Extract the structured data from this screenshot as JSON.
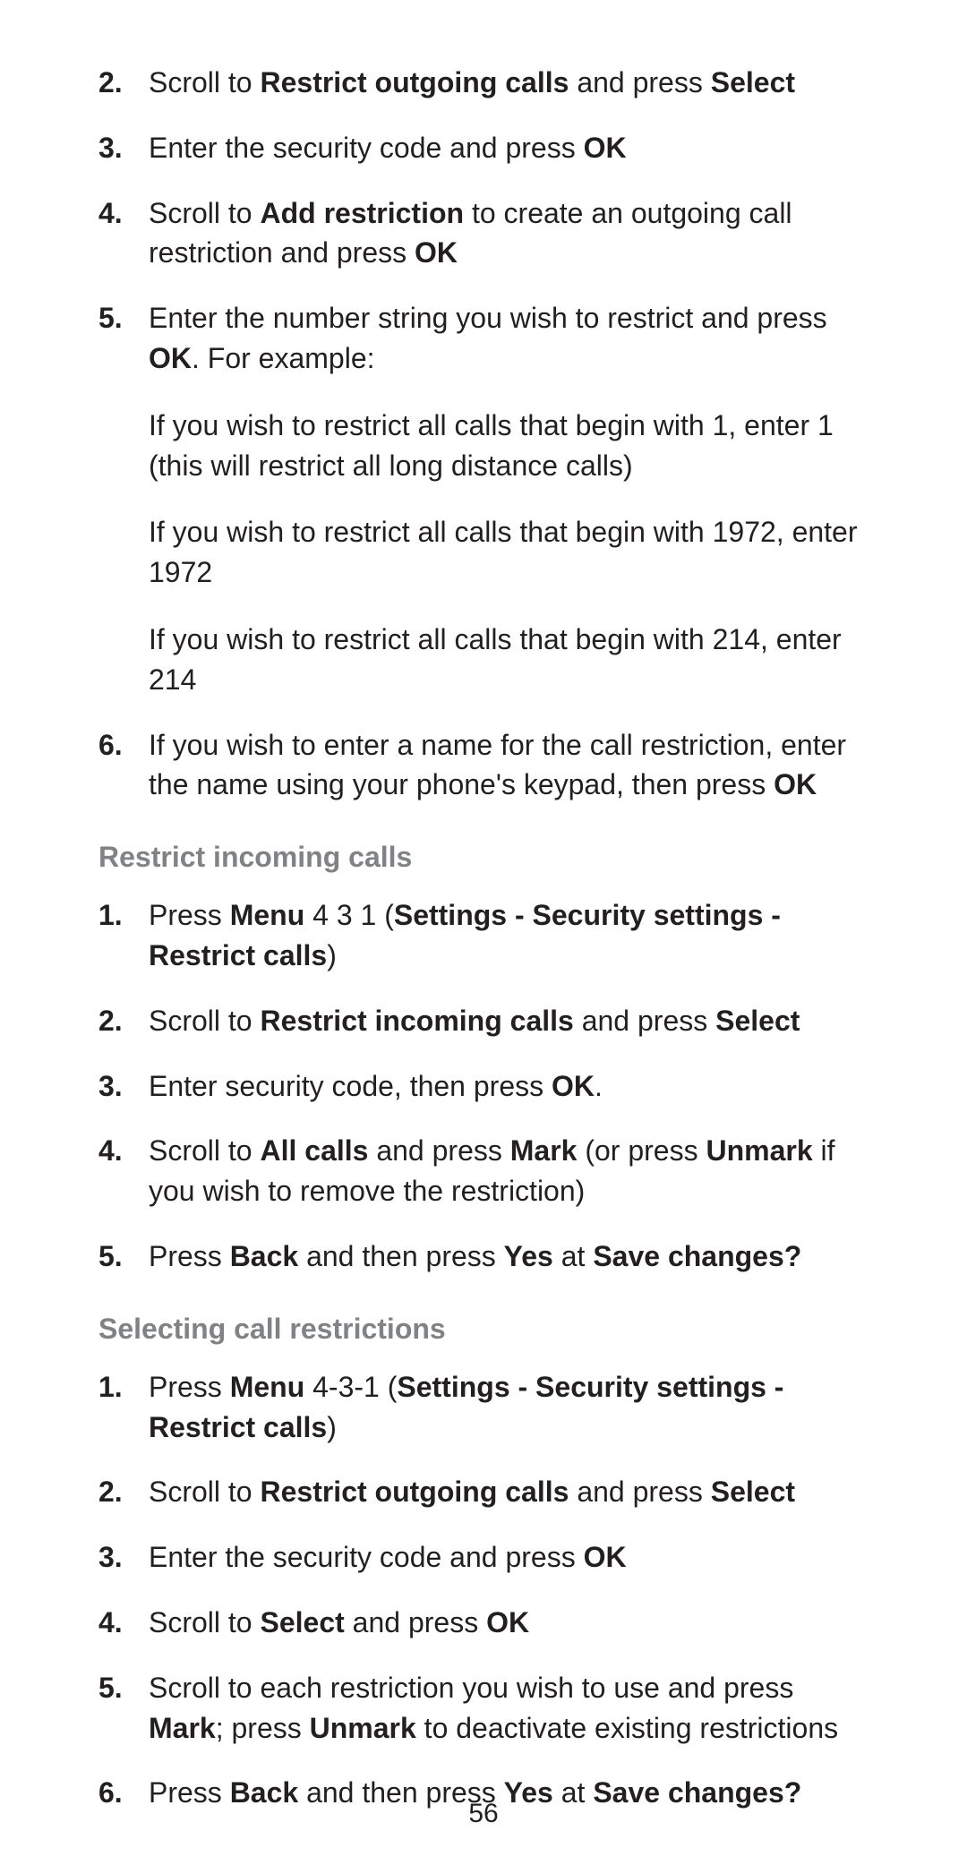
{
  "page_number": "56",
  "sections": [
    {
      "type": "continued_list",
      "items": [
        {
          "n": "2.",
          "spans": [
            {
              "t": "Scroll to ",
              "b": false
            },
            {
              "t": "Restrict outgoing calls",
              "b": true
            },
            {
              "t": " and press ",
              "b": false
            },
            {
              "t": "Select",
              "b": true
            }
          ]
        },
        {
          "n": "3.",
          "spans": [
            {
              "t": "Enter the security code and press ",
              "b": false
            },
            {
              "t": "OK",
              "b": true
            }
          ]
        },
        {
          "n": "4.",
          "spans": [
            {
              "t": "Scroll to ",
              "b": false
            },
            {
              "t": "Add restriction",
              "b": true
            },
            {
              "t": " to create an outgoing call restriction and press ",
              "b": false
            },
            {
              "t": "OK",
              "b": true
            }
          ]
        },
        {
          "n": "5.",
          "spans": [
            {
              "t": "Enter the number string you wish to restrict and press ",
              "b": false
            },
            {
              "t": "OK",
              "b": true
            },
            {
              "t": ". For example:",
              "b": false
            }
          ],
          "sub": [
            "If you wish to restrict all calls that begin with 1, enter 1 (this will restrict all long distance calls)",
            "If you wish to restrict all calls that begin with 1972, enter 1972",
            "If you wish to restrict all calls that begin with 214, enter 214"
          ]
        },
        {
          "n": "6.",
          "spans": [
            {
              "t": "If you wish to enter a name for the call restriction, enter the name using your phone's keypad, then press ",
              "b": false
            },
            {
              "t": "OK",
              "b": true
            }
          ]
        }
      ]
    },
    {
      "type": "heading",
      "title": "Restrict incoming calls"
    },
    {
      "type": "list",
      "items": [
        {
          "n": "1.",
          "spans": [
            {
              "t": "Press ",
              "b": false
            },
            {
              "t": "Menu",
              "b": true
            },
            {
              "t": " 4 3 1 (",
              "b": false
            },
            {
              "t": "Settings - Security settings - Restrict calls",
              "b": true
            },
            {
              "t": ")",
              "b": false
            }
          ]
        },
        {
          "n": "2.",
          "spans": [
            {
              "t": "Scroll to ",
              "b": false
            },
            {
              "t": "Restrict incoming calls",
              "b": true
            },
            {
              "t": " and press ",
              "b": false
            },
            {
              "t": "Select",
              "b": true
            }
          ]
        },
        {
          "n": "3.",
          "spans": [
            {
              "t": "Enter security code, then press ",
              "b": false
            },
            {
              "t": "OK",
              "b": true
            },
            {
              "t": ".",
              "b": false
            }
          ]
        },
        {
          "n": "4.",
          "spans": [
            {
              "t": "Scroll to ",
              "b": false
            },
            {
              "t": "All calls",
              "b": true
            },
            {
              "t": " and press ",
              "b": false
            },
            {
              "t": "Mark",
              "b": true
            },
            {
              "t": " (or press ",
              "b": false
            },
            {
              "t": "Unmark",
              "b": true
            },
            {
              "t": " if you wish to remove the restriction)",
              "b": false
            }
          ]
        },
        {
          "n": "5.",
          "spans": [
            {
              "t": "Press ",
              "b": false
            },
            {
              "t": "Back",
              "b": true
            },
            {
              "t": " and then press ",
              "b": false
            },
            {
              "t": "Yes",
              "b": true
            },
            {
              "t": " at ",
              "b": false
            },
            {
              "t": "Save changes?",
              "b": true
            }
          ]
        }
      ]
    },
    {
      "type": "heading",
      "title": "Selecting call restrictions"
    },
    {
      "type": "list",
      "items": [
        {
          "n": "1.",
          "spans": [
            {
              "t": "Press ",
              "b": false
            },
            {
              "t": "Menu",
              "b": true
            },
            {
              "t": " 4-3-1 (",
              "b": false
            },
            {
              "t": "Settings - Security settings - Restrict calls",
              "b": true
            },
            {
              "t": ")",
              "b": false
            }
          ]
        },
        {
          "n": "2.",
          "spans": [
            {
              "t": "Scroll to ",
              "b": false
            },
            {
              "t": "Restrict outgoing calls",
              "b": true
            },
            {
              "t": " and press ",
              "b": false
            },
            {
              "t": "Select",
              "b": true
            }
          ]
        },
        {
          "n": "3.",
          "spans": [
            {
              "t": "Enter the security code and press ",
              "b": false
            },
            {
              "t": "OK",
              "b": true
            }
          ]
        },
        {
          "n": "4.",
          "spans": [
            {
              "t": "Scroll to ",
              "b": false
            },
            {
              "t": "Select",
              "b": true
            },
            {
              "t": " and press ",
              "b": false
            },
            {
              "t": "OK",
              "b": true
            }
          ]
        },
        {
          "n": "5.",
          "spans": [
            {
              "t": "Scroll to each restriction you wish to use and press ",
              "b": false
            },
            {
              "t": "Mark",
              "b": true
            },
            {
              "t": "; press ",
              "b": false
            },
            {
              "t": "Unmark",
              "b": true
            },
            {
              "t": " to deactivate existing restrictions",
              "b": false
            }
          ]
        },
        {
          "n": "6.",
          "spans": [
            {
              "t": "Press ",
              "b": false
            },
            {
              "t": "Back",
              "b": true
            },
            {
              "t": " and then press ",
              "b": false
            },
            {
              "t": "Yes",
              "b": true
            },
            {
              "t": " at ",
              "b": false
            },
            {
              "t": "Save changes?",
              "b": true
            }
          ]
        }
      ]
    }
  ]
}
